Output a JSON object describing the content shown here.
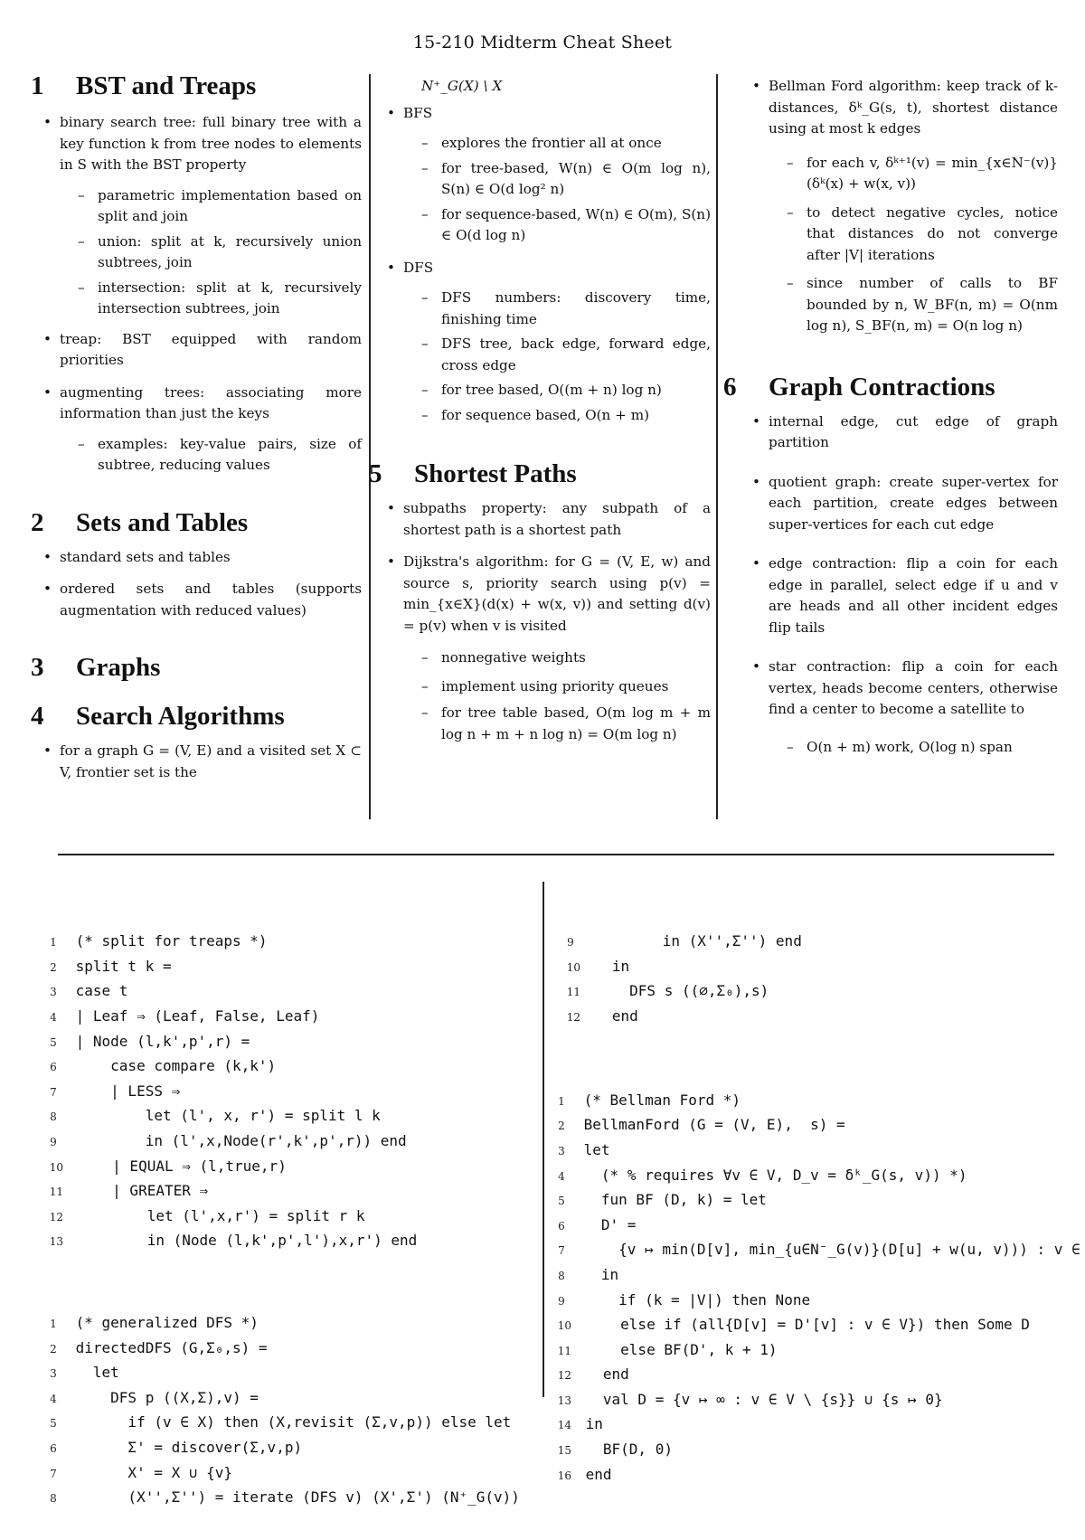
{
  "title": "15-210 Midterm Cheat Sheet",
  "sections": {
    "s1": {
      "num": "1",
      "title": "BST and Treaps",
      "items": [
        {
          "text": "binary search tree: full binary tree with a key function k from tree nodes to elements in S with the BST property",
          "sub": [
            "parametric implementation based on split and join",
            "union: split at k, recursively union subtrees, join",
            "intersection: split at k, recursively intersection subtrees, join"
          ]
        },
        {
          "text": "treap: BST equipped with random priorities"
        },
        {
          "text": "augmenting trees: associating more information than just the keys",
          "sub": [
            "examples: key-value pairs, size of subtree, reducing values"
          ]
        }
      ]
    },
    "s2": {
      "num": "2",
      "title": "Sets and Tables",
      "items": [
        {
          "text": "standard sets and tables"
        },
        {
          "text": "ordered sets and tables (supports augmentation with reduced values)"
        }
      ]
    },
    "s3": {
      "num": "3",
      "title": "Graphs"
    },
    "s4": {
      "num": "4",
      "title": "Search Algorithms",
      "items": [
        {
          "text": "for a graph G = (V, E) and a visited set X ⊂ V, frontier set is the",
          "cont": "N⁺_G(X) \\ X"
        },
        {
          "text": "BFS",
          "sub": [
            "explores the frontier all at once",
            "for tree-based, W(n) ∈ O(m log n), S(n) ∈ O(d log² n)",
            "for sequence-based, W(n) ∈ O(m), S(n) ∈ O(d log n)"
          ]
        },
        {
          "text": "DFS",
          "sub": [
            "DFS numbers: discovery time, finishing time",
            "DFS tree, back edge, forward edge, cross edge",
            "for tree based, O((m + n) log n)",
            "for sequence based, O(n + m)"
          ]
        }
      ]
    },
    "s5": {
      "num": "5",
      "title": "Shortest Paths",
      "items": [
        {
          "text": "subpaths property: any subpath of a shortest path is a shortest path"
        },
        {
          "text": "Dijkstra's algorithm: for G = (V, E, w) and source s, priority search using p(v) = min_{x∈X}(d(x) + w(x, v)) and setting d(v) = p(v) when v is visited",
          "sub": [
            "nonnegative weights",
            "implement using priority queues",
            "for tree table based, O(m log m + m log n + m + n log n) = O(m log n)"
          ]
        },
        {
          "text": "Bellman Ford algorithm: keep track of k-distances, δᵏ_G(s, t), shortest distance using at most k edges",
          "sub": [
            "for each v, δᵏ⁺¹(v) = min_{x∈N⁻(v)}(δᵏ(x) + w(x, v))",
            "to detect negative cycles, notice that distances do not converge after |V| iterations",
            "since number of calls to BF bounded by n, W_BF(n, m) = O(nm log n), S_BF(n, m) = O(n log n)"
          ]
        }
      ]
    },
    "s6": {
      "num": "6",
      "title": "Graph Contractions",
      "items": [
        {
          "text": "internal edge, cut edge of graph partition"
        },
        {
          "text": "quotient graph: create super-vertex for each partition, create edges between super-vertices for each cut edge"
        },
        {
          "text": "edge contraction: flip a coin for each edge in parallel, select edge if u and v are heads and all other incident edges flip tails"
        },
        {
          "text": "star contraction: flip a coin for each vertex, heads become centers, otherwise find a center to become a satellite to",
          "sub": [
            "O(n + m) work, O(log n) span"
          ]
        }
      ]
    }
  },
  "code": {
    "split": [
      {
        "n": "1",
        "t": "(* split for treaps *)"
      },
      {
        "n": "2",
        "t": "split t k ="
      },
      {
        "n": "3",
        "t": "case t"
      },
      {
        "n": "4",
        "t": "| Leaf ⇒ (Leaf, False, Leaf)"
      },
      {
        "n": "5",
        "t": "| Node (l,k',p',r) ="
      },
      {
        "n": "6",
        "t": "    case compare (k,k')"
      },
      {
        "n": "7",
        "t": "    | LESS ⇒"
      },
      {
        "n": "8",
        "t": "        let (l', x, r') = split l k"
      },
      {
        "n": "9",
        "t": "        in (l',x,Node(r',k',p',r)) end"
      },
      {
        "n": "10",
        "t": "    | EQUAL ⇒ (l,true,r)"
      },
      {
        "n": "11",
        "t": "    | GREATER ⇒"
      },
      {
        "n": "12",
        "t": "        let (l',x,r') = split r k"
      },
      {
        "n": "13",
        "t": "        in (Node (l,k',p',l'),x,r') end"
      }
    ],
    "dfs": [
      {
        "n": "1",
        "t": "(* generalized DFS *)"
      },
      {
        "n": "2",
        "t": "directedDFS (G,Σ₀,s) ="
      },
      {
        "n": "3",
        "t": "  let"
      },
      {
        "n": "4",
        "t": "    DFS p ((X,Σ),v) ="
      },
      {
        "n": "5",
        "t": "      if (v ∈ X) then (X,revisit (Σ,v,p)) else let"
      },
      {
        "n": "6",
        "t": "      Σ' = discover(Σ,v,p)"
      },
      {
        "n": "7",
        "t": "      X' = X ∪ {v}"
      },
      {
        "n": "8",
        "t": "      (X'',Σ'') = iterate (DFS v) (X',Σ') (N⁺_G(v))"
      },
      {
        "n": "9",
        "t": "        in (X'',Σ'') end"
      },
      {
        "n": "10",
        "t": "  in"
      },
      {
        "n": "11",
        "t": "    DFS s ((∅,Σ₀),s)"
      },
      {
        "n": "12",
        "t": "  end"
      }
    ],
    "bellman": [
      {
        "n": "1",
        "t": "(* Bellman Ford *)"
      },
      {
        "n": "2",
        "t": "BellmanFord (G = (V, E),  s) ="
      },
      {
        "n": "3",
        "t": "let"
      },
      {
        "n": "4",
        "t": "  (* % requires ∀v ∈ V, D_v = δᵏ_G(s, v)) *)"
      },
      {
        "n": "5",
        "t": "  fun BF (D, k) = let"
      },
      {
        "n": "6",
        "t": "  D' ="
      },
      {
        "n": "7",
        "t": "    {v ↦ min(D[v], min_{u∈N⁻_G(v)}(D[u] + w(u, v))) : v ∈ V}"
      },
      {
        "n": "8",
        "t": "  in"
      },
      {
        "n": "9",
        "t": "    if (k = |V|) then None"
      },
      {
        "n": "10",
        "t": "    else if (all{D[v] = D'[v] : v ∈ V}) then Some D"
      },
      {
        "n": "11",
        "t": "    else BF(D', k + 1)"
      },
      {
        "n": "12",
        "t": "  end"
      },
      {
        "n": "13",
        "t": "  val D = {v ↦ ∞ : v ∈ V \\ {s}} ∪ {s ↦ 0}"
      },
      {
        "n": "14",
        "t": "in"
      },
      {
        "n": "15",
        "t": "  BF(D, 0)"
      },
      {
        "n": "16",
        "t": "end"
      }
    ]
  }
}
